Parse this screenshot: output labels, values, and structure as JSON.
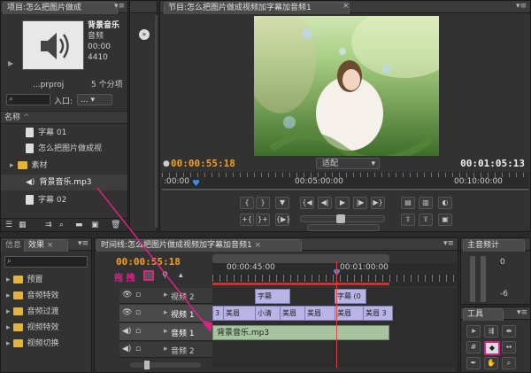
{
  "project_panel": {
    "tab_title": "项目:怎么把图片做成",
    "preview": {
      "name": "背景音乐",
      "type": "音频",
      "duration": "00:00",
      "rate": "4410"
    },
    "project_file": "...prproj",
    "item_count": "5 个分项",
    "entry_label": "入口:",
    "entry_value": "...",
    "column_name": "名称",
    "items": [
      {
        "label": "字幕 01",
        "kind": "file"
      },
      {
        "label": "怎么把图片做成视",
        "kind": "file"
      },
      {
        "label": "素材",
        "kind": "folder"
      },
      {
        "label": "背景音乐.mp3",
        "kind": "audio"
      },
      {
        "label": "字幕 02",
        "kind": "file"
      }
    ]
  },
  "program_monitor": {
    "tab_title": "节目:怎么把图片做成视频加字幕加音频1",
    "current_time": "00:00:55:18",
    "fit_label": "适配",
    "duration": "00:01:05:13",
    "ruler": {
      "start": ":00:00",
      "mid": "00:05:00:00",
      "end": "00:10:00:00"
    }
  },
  "effects_panel": {
    "tab_info": "信息",
    "tab_effects": "效果",
    "items": [
      {
        "label": "预置"
      },
      {
        "label": "音频特效"
      },
      {
        "label": "音频过渡"
      },
      {
        "label": "视频特效"
      },
      {
        "label": "视频切换"
      }
    ]
  },
  "timeline": {
    "tab_title": "时间线:怎么把图片做成视频加字幕加音频1",
    "current_time": "00:00:55:18",
    "ruler_labels": [
      "00:00:45:00",
      "00:01:00:00"
    ],
    "tracks": [
      {
        "name": "视频 2"
      },
      {
        "name": "视频 1"
      },
      {
        "name": "音频 1"
      },
      {
        "name": "音频 2"
      }
    ],
    "v2_clips": [
      "字幕",
      "字幕 (0"
    ],
    "v1_clips": [
      "3",
      "美眉",
      "小清",
      "美眉",
      "美眉",
      "美眉",
      "美眉 3"
    ],
    "audio_clip": "背景音乐.mp3"
  },
  "audio_master": {
    "tab_title": "主音频计",
    "scale": [
      "0",
      "-6"
    ]
  },
  "tools_panel": {
    "tab_title": "工具"
  },
  "annotations": {
    "red_label": "拖 拽"
  },
  "colors": {
    "accent_timecode": "#f0a020",
    "playhead": "#e04040",
    "annotation": "#e0208a",
    "video_clip": "#b8b4e6",
    "audio_clip": "#a6c4a0"
  }
}
